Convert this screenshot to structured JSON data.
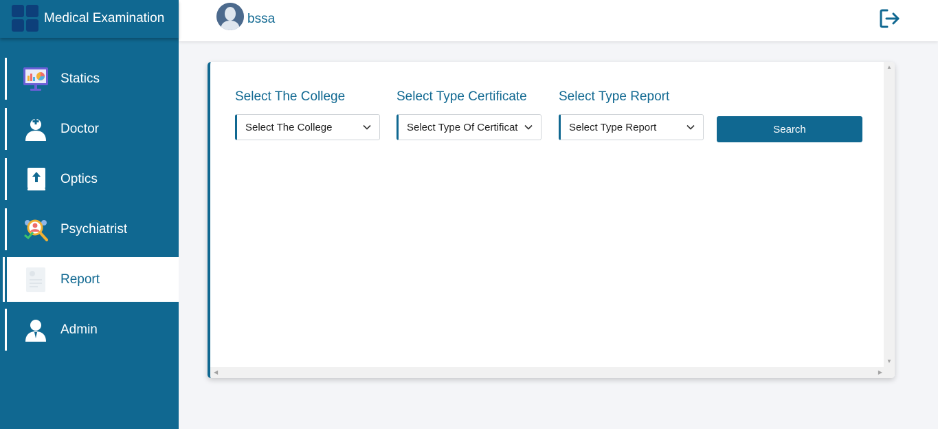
{
  "app": {
    "title": "Medical Examination"
  },
  "user": {
    "name": "bssa"
  },
  "sidebar": {
    "items": [
      {
        "label": "Statics",
        "icon": "presentation-chart-icon",
        "active": false
      },
      {
        "label": "Doctor",
        "icon": "doctor-icon",
        "active": false
      },
      {
        "label": "Optics",
        "icon": "upload-book-icon",
        "active": false
      },
      {
        "label": "Psychiatrist",
        "icon": "psychiatrist-icon",
        "active": false
      },
      {
        "label": "Report",
        "icon": "report-document-icon",
        "active": true
      },
      {
        "label": "Admin",
        "icon": "admin-user-icon",
        "active": false
      }
    ]
  },
  "filters": {
    "college": {
      "label": "Select The College",
      "value": "Select The College"
    },
    "certificate": {
      "label": "Select Type Certificate",
      "value": "Select Type Of Certificat"
    },
    "report": {
      "label": "Select Type Report",
      "value": "Select Type Report"
    },
    "search_label": "Search"
  },
  "colors": {
    "primary": "#106891",
    "background": "#f4f5f8",
    "logo": "#0d3f7a"
  }
}
